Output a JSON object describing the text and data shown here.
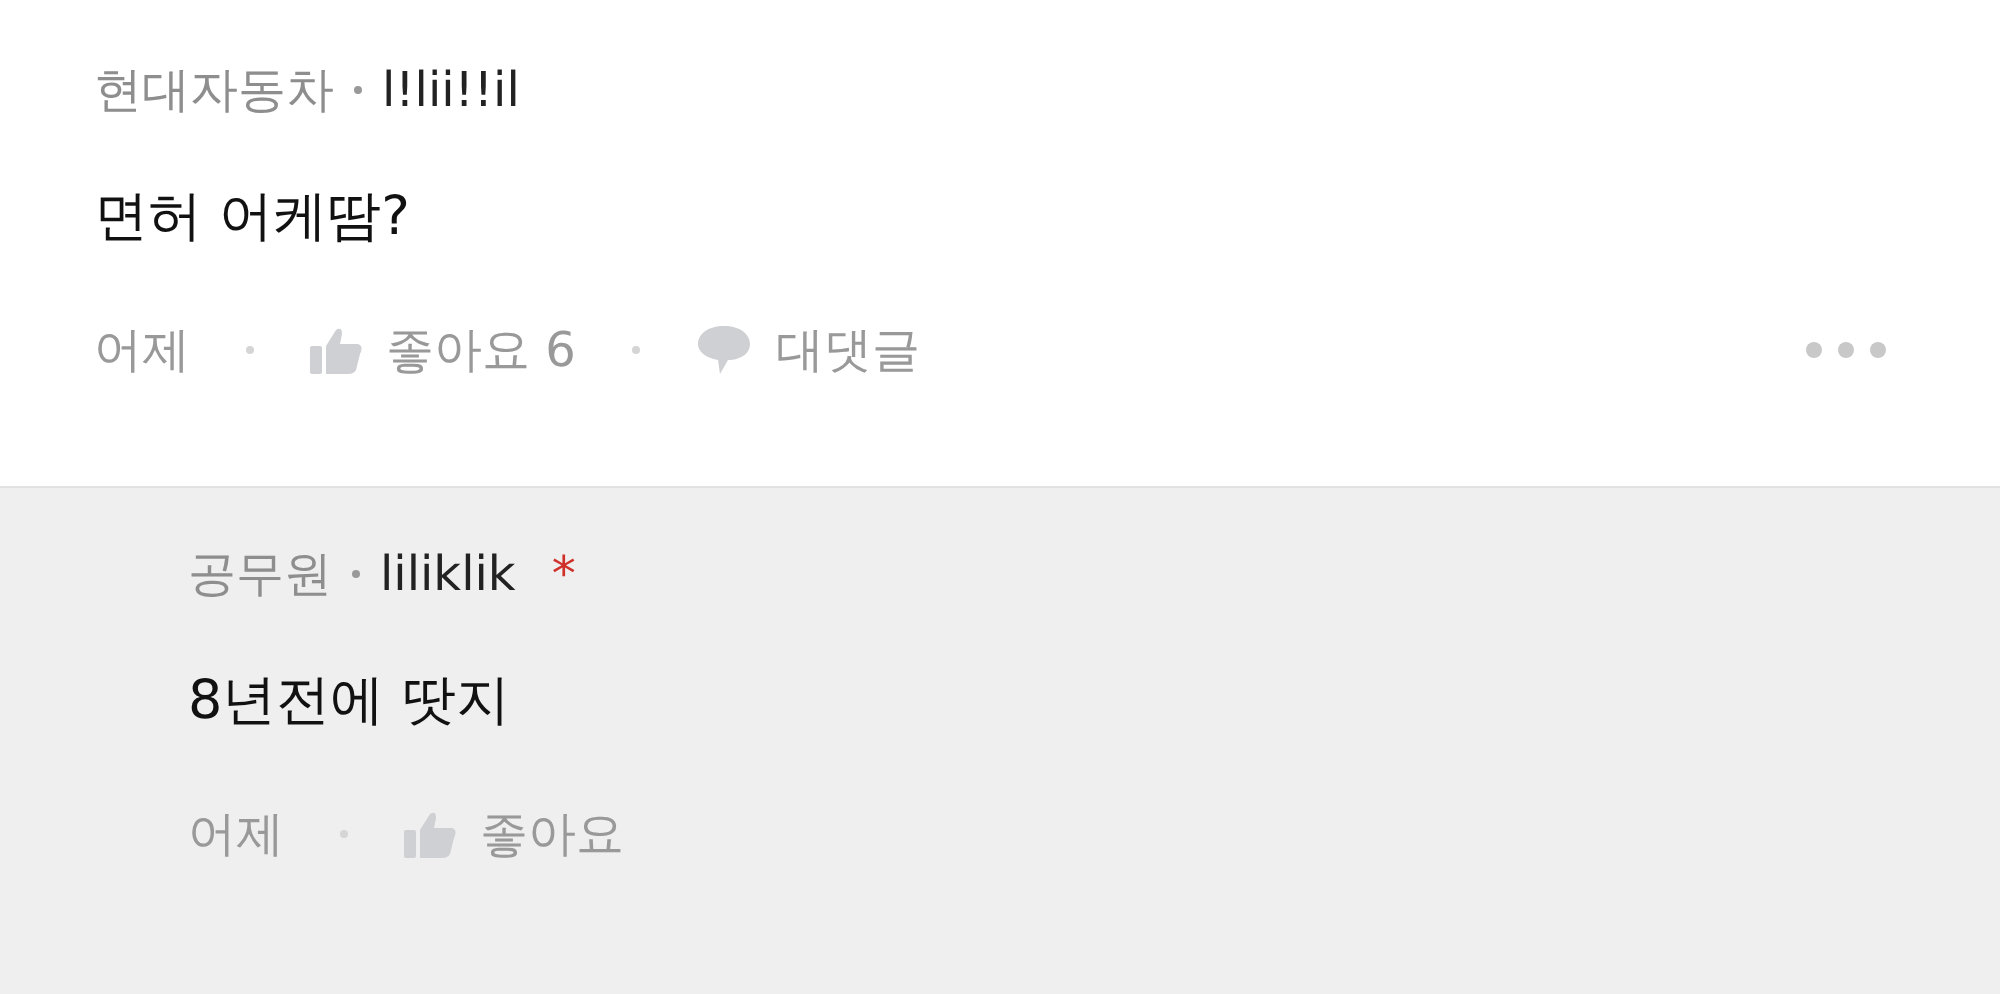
{
  "comments": [
    {
      "kind": "comment",
      "group": "현대자동차",
      "nickname": "l!lii!!il",
      "body": "면허 어케땀?",
      "time": "어제",
      "like_label": "좋아요",
      "like_count": "6",
      "reply_label": "대댓글",
      "more": true
    },
    {
      "kind": "reply",
      "group": "공무원",
      "nickname": "liliklik",
      "badge": "*",
      "body": "8년전에 땃지",
      "time": "어제",
      "like_label": "좋아요"
    }
  ]
}
